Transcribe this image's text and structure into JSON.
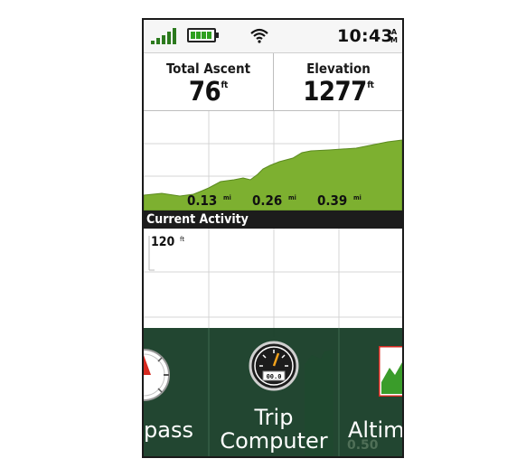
{
  "status_bar": {
    "time": "10:43",
    "ampm_top": "A",
    "ampm_bottom": "M",
    "icons": [
      "signal-icon",
      "battery-icon",
      "wifi-icon"
    ]
  },
  "fields": [
    {
      "label": "Total Ascent",
      "value": "76",
      "unit": "ft"
    },
    {
      "label": "Elevation",
      "value": "1277",
      "unit": "ft"
    }
  ],
  "chart": {
    "x_ticks": [
      {
        "value": "0.13",
        "unit": "mi"
      },
      {
        "value": "0.26",
        "unit": "mi"
      },
      {
        "value": "0.39",
        "unit": "mi"
      }
    ],
    "fill_color": "#7db030"
  },
  "activity": {
    "title": "Current Activity",
    "scale_value": "120",
    "scale_unit": "ft",
    "bottom_tick": "0.50"
  },
  "dock": {
    "items": [
      {
        "label": "pass",
        "icon": "compass-icon"
      },
      {
        "label_line1": "Trip",
        "label_line2": "Computer",
        "icon": "trip-computer-icon",
        "icon_text": "00.0"
      },
      {
        "label": "Altim",
        "icon": "altimeter-icon"
      }
    ]
  }
}
